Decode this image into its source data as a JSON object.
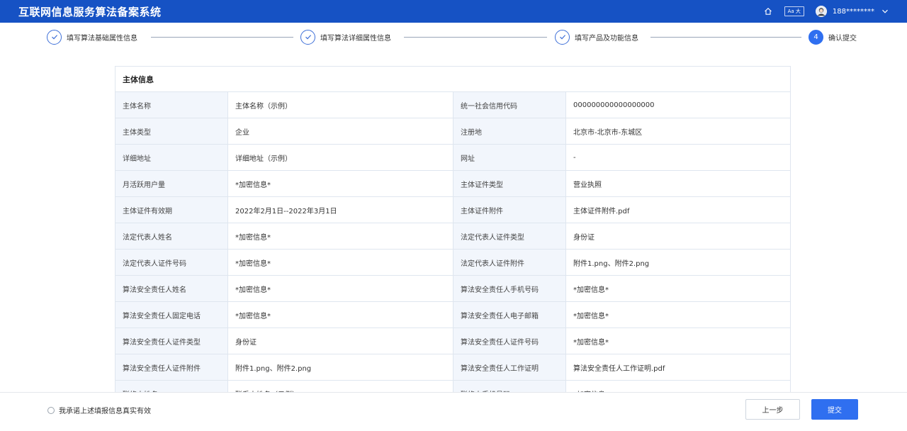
{
  "header": {
    "title": "互联网信息服务算法备案系统",
    "font_toggle": "Aa 大",
    "user": "188********",
    "icons": [
      "home-icon",
      "avatar",
      "chevron-down-icon"
    ]
  },
  "steps": [
    {
      "label": "填写算法基础属性信息",
      "state": "done"
    },
    {
      "label": "填写算法详细属性信息",
      "state": "done"
    },
    {
      "label": "填写产品及功能信息",
      "state": "done"
    },
    {
      "label": "确认提交",
      "number": "4",
      "state": "active"
    }
  ],
  "section": {
    "title": "主体信息",
    "rows": [
      {
        "l1": "主体名称",
        "v1": "主体名称（示例）",
        "l2": "统一社会信用代码",
        "v2": "000000000000000000"
      },
      {
        "l1": "主体类型",
        "v1": "企业",
        "l2": "注册地",
        "v2": "北京市-北京市-东城区"
      },
      {
        "l1": "详细地址",
        "v1": "详细地址（示例）",
        "l2": "网址",
        "v2": "-"
      },
      {
        "l1": "月活跃用户量",
        "v1": "*加密信息*",
        "l2": "主体证件类型",
        "v2": "营业执照"
      },
      {
        "l1": "主体证件有效期",
        "v1": "2022年2月1日--2022年3月1日",
        "l2": "主体证件附件",
        "v2": "主体证件附件.pdf"
      },
      {
        "l1": "法定代表人姓名",
        "v1": "*加密信息*",
        "l2": "法定代表人证件类型",
        "v2": "身份证"
      },
      {
        "l1": "法定代表人证件号码",
        "v1": "*加密信息*",
        "l2": "法定代表人证件附件",
        "v2": "附件1.png、附件2.png"
      },
      {
        "l1": "算法安全责任人姓名",
        "v1": "*加密信息*",
        "l2": "算法安全责任人手机号码",
        "v2": "*加密信息*"
      },
      {
        "l1": "算法安全责任人固定电话",
        "v1": "*加密信息*",
        "l2": "算法安全责任人电子邮箱",
        "v2": "*加密信息*"
      },
      {
        "l1": "算法安全责任人证件类型",
        "v1": "身份证",
        "l2": "算法安全责任人证件号码",
        "v2": "*加密信息*"
      },
      {
        "l1": "算法安全责任人证件附件",
        "v1": "附件1.png、附件2.png",
        "l2": "算法安全责任人工作证明",
        "v2": "算法安全责任人工作证明.pdf"
      },
      {
        "l1": "联络人姓名",
        "v1": "联系人姓名（示例）",
        "l2": "联络人手机号码",
        "v2": "*加密信息*"
      }
    ]
  },
  "footer": {
    "promise": "我承诺上述填报信息真实有效",
    "prev_label": "上一步",
    "submit_label": "提交"
  },
  "colors": {
    "primary": "#1652c4",
    "button": "#2f6ff0",
    "label_bg": "#f2f6fc"
  }
}
